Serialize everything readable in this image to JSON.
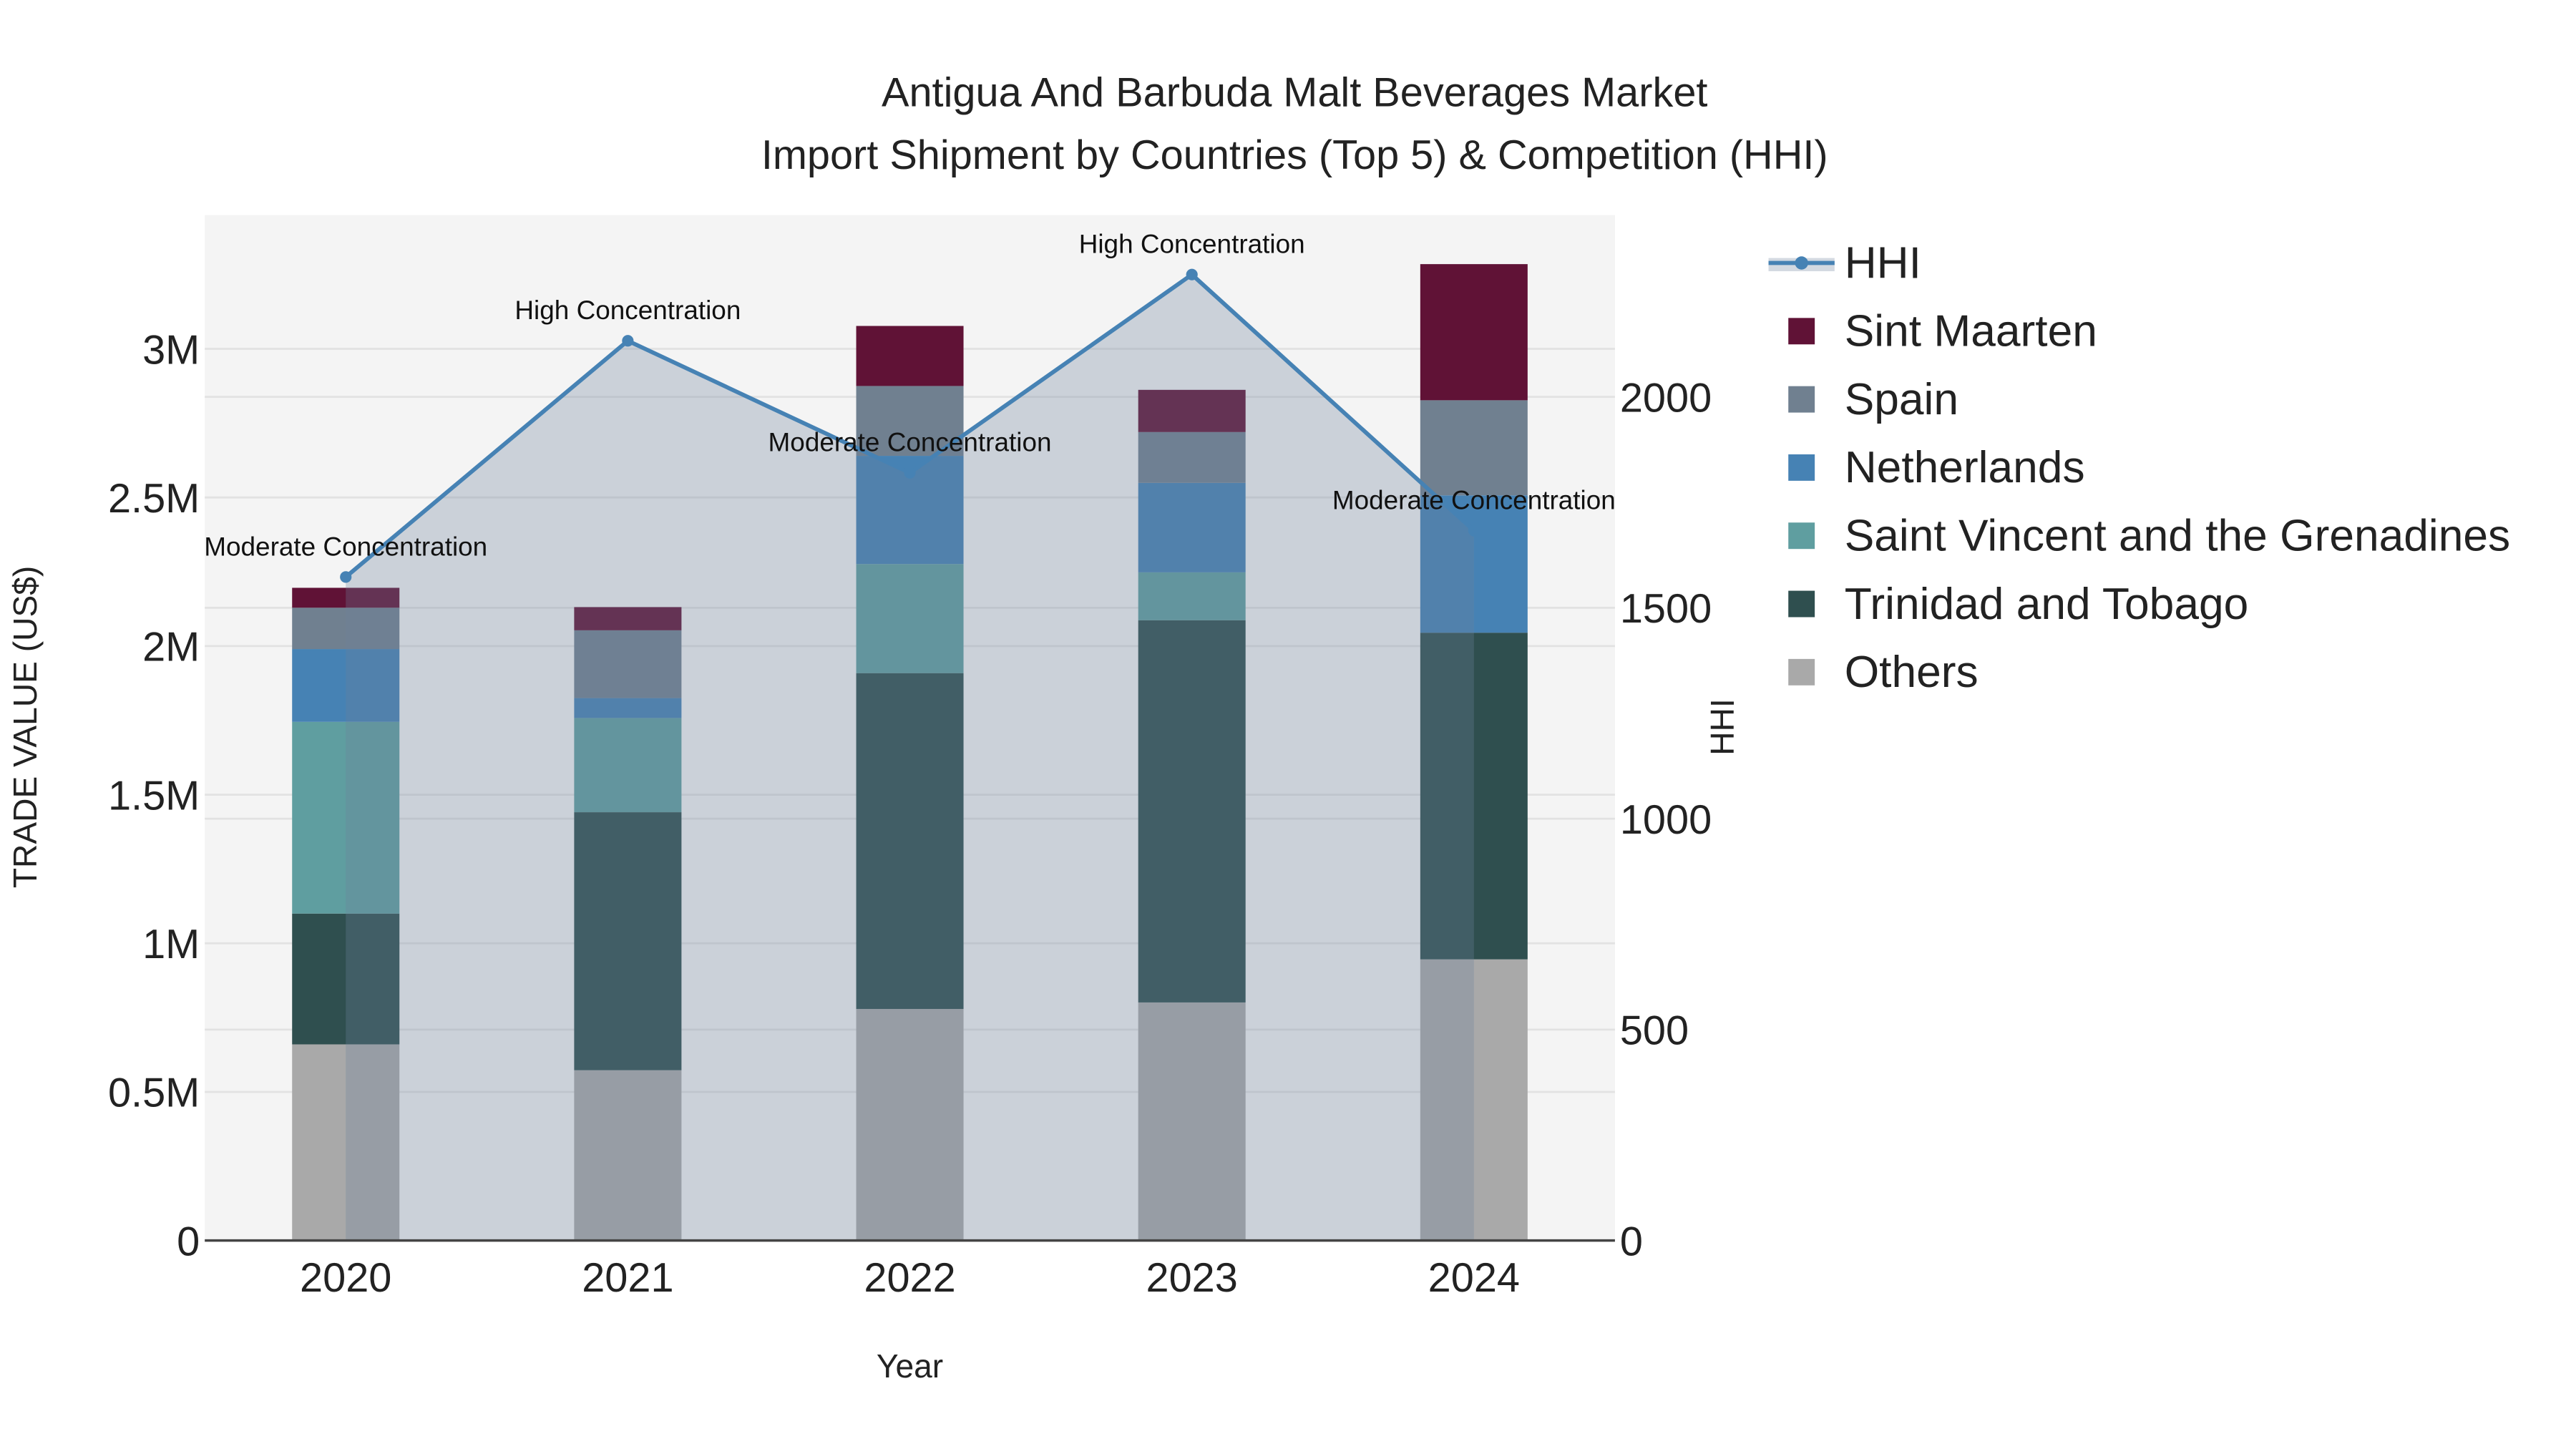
{
  "chart_data": {
    "type": "bar",
    "title_line1": "Antigua And Barbuda Malt Beverages Market",
    "title_line2": "Import Shipment by Countries (Top 5) & Competition (HHI)",
    "xlabel": "Year",
    "ylabel": "TRADE VALUE (US$)",
    "y2label": "HHI",
    "categories": [
      "2020",
      "2021",
      "2022",
      "2023",
      "2024"
    ],
    "ylim": [
      0,
      3450000
    ],
    "y2lim": [
      0,
      2431
    ],
    "yticks": [
      {
        "v": 0,
        "label": "0"
      },
      {
        "v": 500000,
        "label": "0.5M"
      },
      {
        "v": 1000000,
        "label": "1M"
      },
      {
        "v": 1500000,
        "label": "1.5M"
      },
      {
        "v": 2000000,
        "label": "2M"
      },
      {
        "v": 2500000,
        "label": "2.5M"
      },
      {
        "v": 3000000,
        "label": "3M"
      }
    ],
    "y2ticks": [
      {
        "v": 0,
        "label": "0"
      },
      {
        "v": 500,
        "label": "500"
      },
      {
        "v": 1000,
        "label": "1000"
      },
      {
        "v": 1500,
        "label": "1500"
      },
      {
        "v": 2000,
        "label": "2000"
      }
    ],
    "series": [
      {
        "name": "Others",
        "color": "#a9a9a9",
        "values": [
          660000,
          573000,
          779000,
          801000,
          946000
        ]
      },
      {
        "name": "Trinidad and Tobago",
        "color": "#2f4f4f",
        "values": [
          440000,
          868000,
          1130000,
          1286000,
          1099000
        ]
      },
      {
        "name": "Saint Vincent and the Grenadines",
        "color": "#5f9ea0",
        "values": [
          645000,
          317000,
          367000,
          161000,
          0
        ]
      },
      {
        "name": "Netherlands",
        "color": "#4682b4",
        "values": [
          245000,
          67000,
          364000,
          301000,
          462000
        ]
      },
      {
        "name": "Spain",
        "color": "#708090",
        "values": [
          139000,
          228000,
          235000,
          171000,
          320000
        ]
      },
      {
        "name": "Sint Maarten",
        "color": "#601236",
        "values": [
          67000,
          78000,
          202000,
          142000,
          458000
        ]
      }
    ],
    "hhi": {
      "name": "HHI",
      "color": "#4682b4",
      "values": [
        1573,
        2133,
        1820,
        2290,
        1683
      ],
      "annotations": [
        "Moderate Concentration",
        "High Concentration",
        "Moderate Concentration",
        "High Concentration",
        "Moderate Concentration"
      ]
    },
    "legend_order": [
      "HHI",
      "Sint Maarten",
      "Spain",
      "Netherlands",
      "Saint Vincent and the Grenadines",
      "Trinidad and Tobago",
      "Others"
    ],
    "legend_position": "right",
    "grid": true
  }
}
